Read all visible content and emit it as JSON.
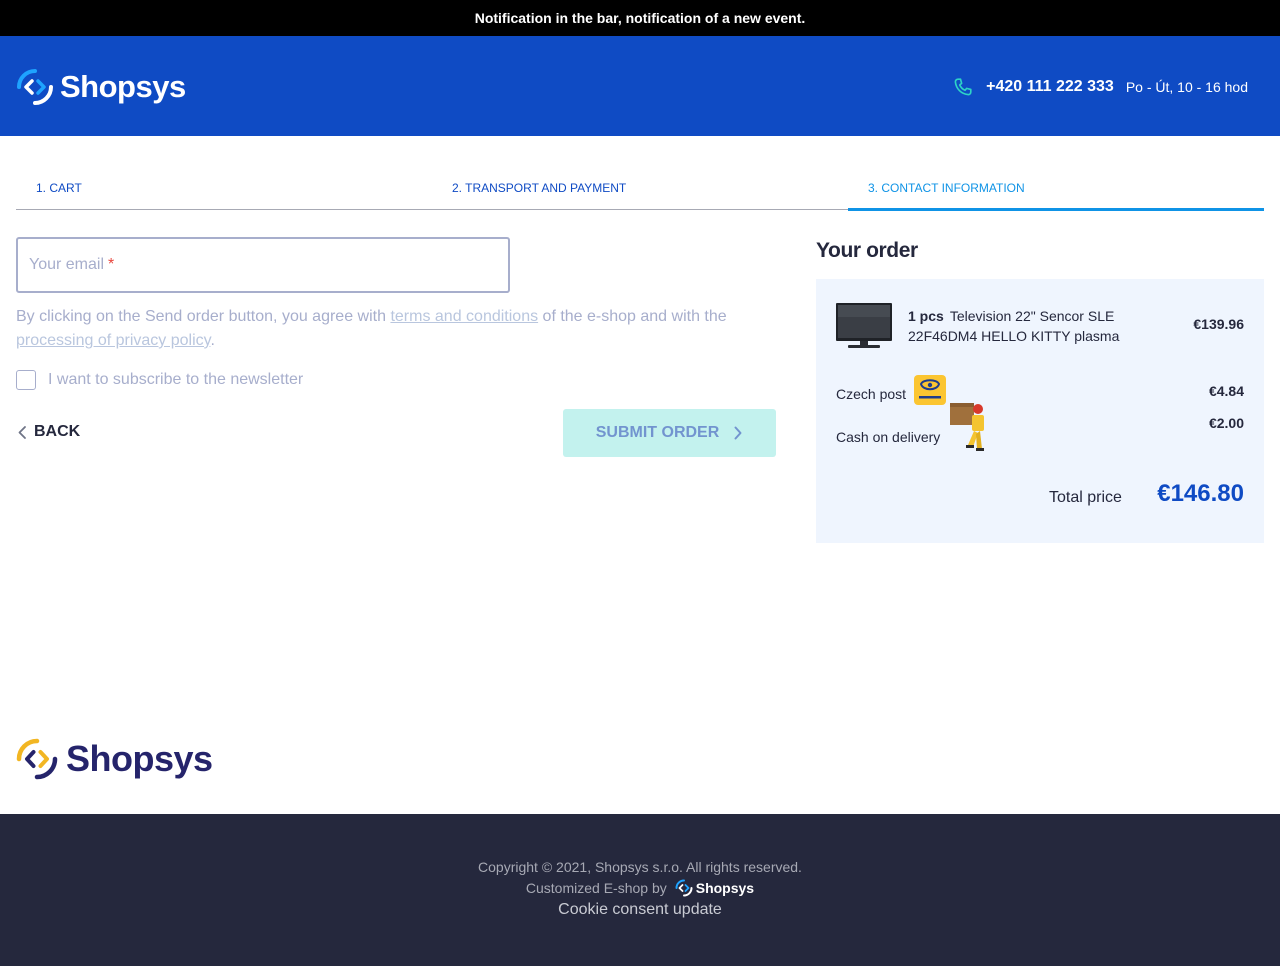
{
  "notification": {
    "text": "Notification in the bar, notification of a new event."
  },
  "header": {
    "logo_text": "Shopsys",
    "phone": "+420 111 222 333",
    "hours": "Po - Út, 10 - 16 hod"
  },
  "steps": [
    {
      "label": "1. CART"
    },
    {
      "label": "2. TRANSPORT AND PAYMENT"
    },
    {
      "label": "3. CONTACT INFORMATION",
      "active": true
    }
  ],
  "form": {
    "email_placeholder": "Your email",
    "email_value": "",
    "required_mark": "*",
    "agreement_pre": "By clicking on the Send order button, you agree with ",
    "terms_link": "terms and conditions",
    "agreement_mid": " of the e-shop and with the ",
    "privacy_link": "processing of privacy policy",
    "agreement_end": ".",
    "newsletter_label": "I want to subscribe to the newsletter",
    "newsletter_checked": false,
    "back_label": "BACK",
    "submit_label": "SUBMIT ORDER"
  },
  "order": {
    "title": "Your order",
    "product": {
      "quantity": "1 pcs",
      "name": "Television 22\" Sencor SLE 22F46DM4 HELLO KITTY plasma",
      "price": "€139.96"
    },
    "transport": {
      "name": "Czech post",
      "price": "€4.84"
    },
    "payment": {
      "name": "Cash on delivery",
      "price": "€2.00"
    },
    "total_label": "Total price",
    "total_value": "€146.80"
  },
  "footer": {
    "logo_text": "Shopsys",
    "copyright": "Copyright © 2021, Shopsys s.r.o. All rights reserved.",
    "customized_by": "Customized E-shop by",
    "customized_logo": "Shopsys",
    "cookie_link": "Cookie consent update"
  },
  "colors": {
    "brand_blue": "#0f4bc4",
    "accent_cyan": "#0f93e6",
    "footer_bg": "#25283d",
    "submit_bg": "#c3f2ee",
    "order_bg": "#eff5fe"
  }
}
